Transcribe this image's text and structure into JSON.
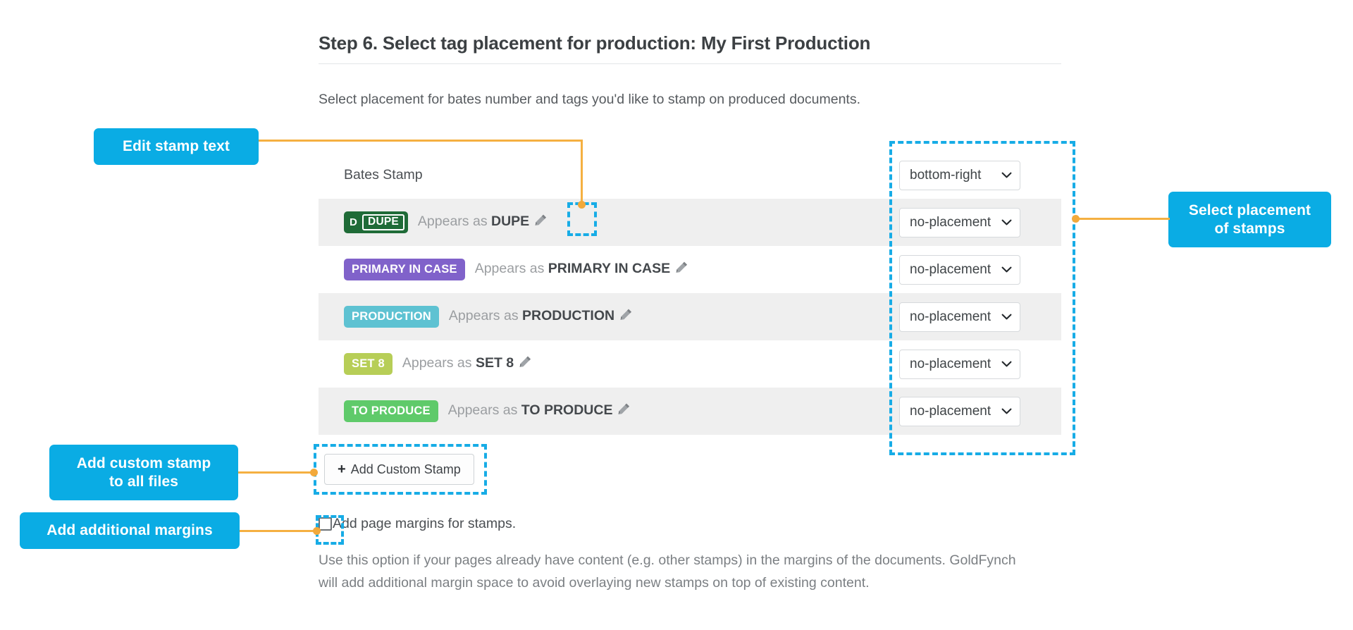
{
  "page": {
    "title": "Step 6. Select tag placement for production: My First Production",
    "subtitle": "Select placement for bates number and tags you'd like to stamp on produced documents."
  },
  "rows": [
    {
      "kind": "bates",
      "label": "Bates Stamp",
      "placement": "bottom-right",
      "shaded": false
    },
    {
      "kind": "tag",
      "chip_text": "DUPE",
      "chip_prefix": "D",
      "chip_color": "#1f6b37",
      "chip_text_color": "#ffffff",
      "appears_prefix": "Appears as",
      "appears_value": "DUPE",
      "placement": "no-placement",
      "shaded": true
    },
    {
      "kind": "tag",
      "chip_text": "PRIMARY IN CASE",
      "chip_color": "#8062ca",
      "chip_text_color": "#ffffff",
      "appears_prefix": "Appears as",
      "appears_value": "PRIMARY IN CASE",
      "placement": "no-placement",
      "shaded": false
    },
    {
      "kind": "tag",
      "chip_text": "PRODUCTION",
      "chip_color": "#5ec2d2",
      "chip_text_color": "#ffffff",
      "appears_prefix": "Appears as",
      "appears_value": "PRODUCTION",
      "placement": "no-placement",
      "shaded": true
    },
    {
      "kind": "tag",
      "chip_text": "SET 8",
      "chip_color": "#b7ce57",
      "chip_text_color": "#ffffff",
      "appears_prefix": "Appears as",
      "appears_value": "SET 8",
      "placement": "no-placement",
      "shaded": false
    },
    {
      "kind": "tag",
      "chip_text": "TO PRODUCE",
      "chip_color": "#5fca6a",
      "chip_text_color": "#ffffff",
      "appears_prefix": "Appears as",
      "appears_value": "TO PRODUCE",
      "placement": "no-placement",
      "shaded": true
    }
  ],
  "add_custom_stamp": {
    "label": "Add Custom Stamp",
    "plus": "+"
  },
  "margins": {
    "checkbox_checked": false,
    "label": "Add page margins for stamps.",
    "description": "Use this option if your pages already have content (e.g. other stamps) in the margins of the documents. GoldFynch will add additional margin space to avoid overlaying new stamps on top of existing content."
  },
  "callouts": [
    {
      "id": "edit-stamp-text",
      "line1": "Edit stamp text",
      "line2": ""
    },
    {
      "id": "select-placement",
      "line1": "Select placement",
      "line2": "of stamps"
    },
    {
      "id": "add-custom-stamp",
      "line1": "Add custom stamp",
      "line2": "to all files"
    },
    {
      "id": "add-additional-margins",
      "line1": "Add additional margins",
      "line2": ""
    }
  ],
  "colors": {
    "callout_blue": "#0aace4",
    "dash_blue": "#17ace6",
    "connector_orange": "#f5b041",
    "row_shade": "#efefef"
  }
}
